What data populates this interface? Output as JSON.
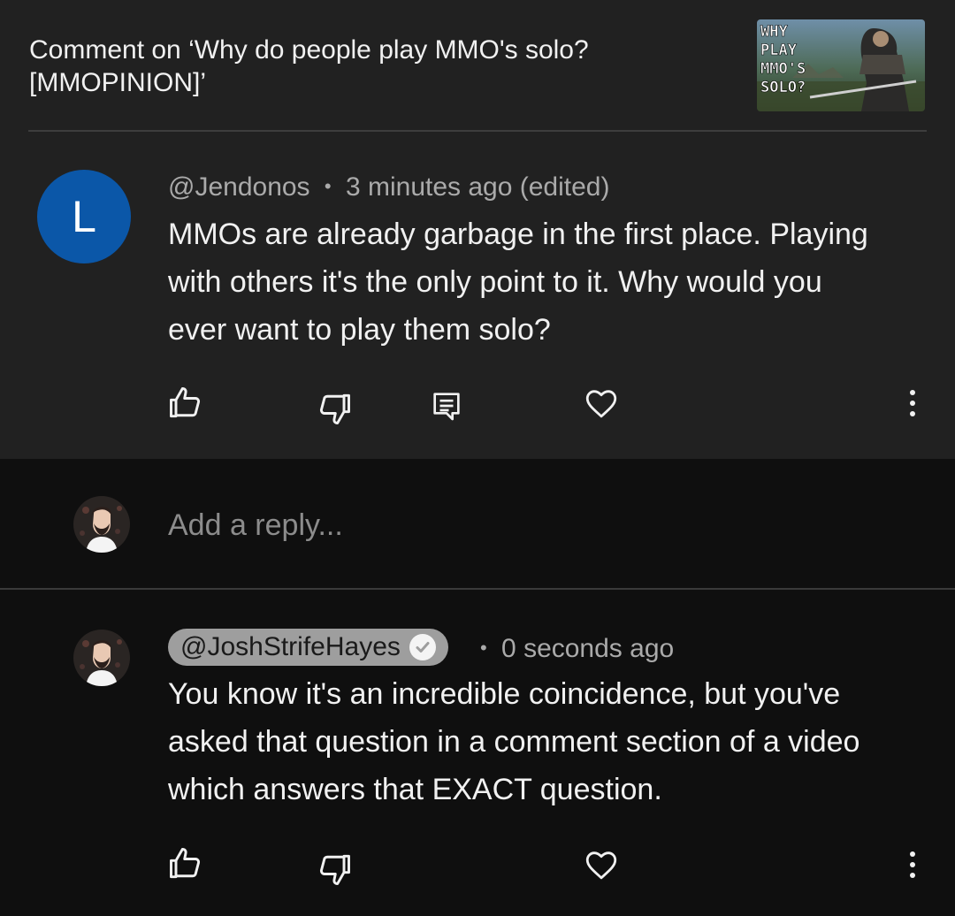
{
  "header": {
    "title": "Comment on ‘Why do people play MMO's solo? [MMOPINION]’",
    "thumbnail": {
      "text_lines": [
        "WHY",
        "PLAY",
        "MMO'S",
        "SOLO?"
      ]
    }
  },
  "comment": {
    "avatar_letter": "L",
    "avatar_color": "#0b57a8",
    "author": "@Jendonos",
    "separator": "•",
    "time": "3 minutes ago (edited)",
    "text": "MMOs are already garbage in the first place. Playing with others it's the only point to it. Why would you ever want to play them solo?",
    "actions": [
      "like-icon",
      "dislike-icon",
      "reply-icon",
      "heart-icon",
      "more-vert-icon"
    ]
  },
  "reply_box": {
    "placeholder": "Add a reply..."
  },
  "reply": {
    "author": "@JoshStrifeHayes",
    "verified": true,
    "separator": "•",
    "time": "0 seconds ago",
    "text": "You know it's an incredible coincidence, but you've asked that question in a comment section of a video which answers that EXACT question.",
    "actions": [
      "like-icon",
      "dislike-icon",
      "heart-icon",
      "more-vert-icon"
    ]
  },
  "colors": {
    "surface": "#212121",
    "background": "#0f0f0f",
    "text": "#f1f1f1",
    "secondary_text": "#aaaaaa",
    "creator_chip": "#9e9e9e"
  }
}
